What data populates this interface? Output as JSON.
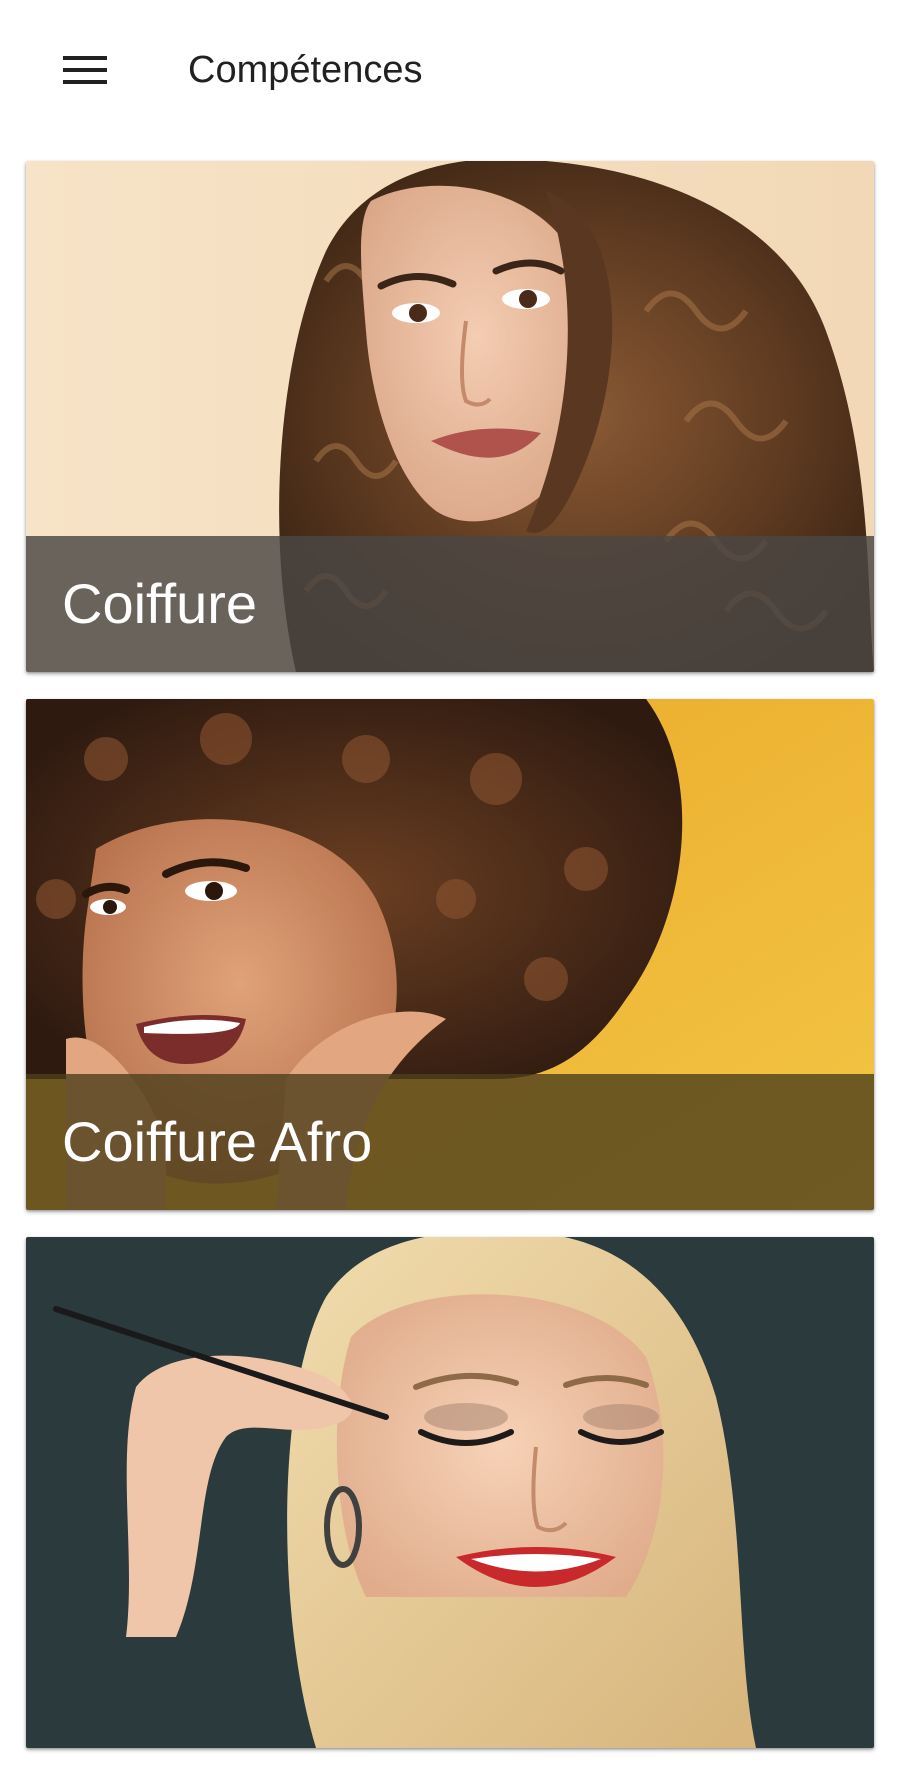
{
  "app_bar": {
    "title": "Compétences",
    "menu_icon": "hamburger-menu-icon"
  },
  "skills": [
    {
      "label": "Coiffure",
      "photo": "curly-brown-hair-woman-photo",
      "caption_color": "#4a4744"
    },
    {
      "label": "Coiffure Afro",
      "photo": "afro-curly-hair-woman-photo",
      "caption_color": "#4d3f1c"
    },
    {
      "label": "",
      "photo": "blonde-woman-eye-makeup-photo",
      "caption_color": ""
    }
  ],
  "colors": {
    "title_text": "#212121",
    "caption_text": "#ffffff",
    "background": "#ffffff"
  }
}
